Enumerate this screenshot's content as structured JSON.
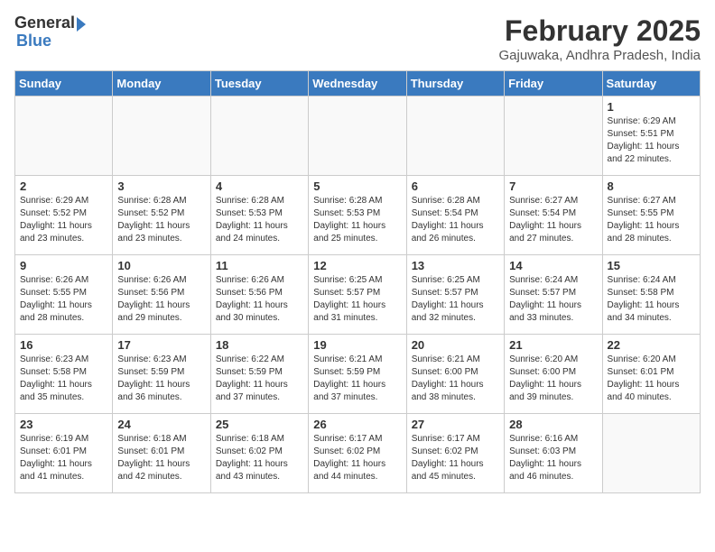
{
  "header": {
    "logo_general": "General",
    "logo_blue": "Blue",
    "month_title": "February 2025",
    "location": "Gajuwaka, Andhra Pradesh, India"
  },
  "weekdays": [
    "Sunday",
    "Monday",
    "Tuesday",
    "Wednesday",
    "Thursday",
    "Friday",
    "Saturday"
  ],
  "weeks": [
    [
      {
        "day": "",
        "info": ""
      },
      {
        "day": "",
        "info": ""
      },
      {
        "day": "",
        "info": ""
      },
      {
        "day": "",
        "info": ""
      },
      {
        "day": "",
        "info": ""
      },
      {
        "day": "",
        "info": ""
      },
      {
        "day": "1",
        "info": "Sunrise: 6:29 AM\nSunset: 5:51 PM\nDaylight: 11 hours\nand 22 minutes."
      }
    ],
    [
      {
        "day": "2",
        "info": "Sunrise: 6:29 AM\nSunset: 5:52 PM\nDaylight: 11 hours\nand 23 minutes."
      },
      {
        "day": "3",
        "info": "Sunrise: 6:28 AM\nSunset: 5:52 PM\nDaylight: 11 hours\nand 23 minutes."
      },
      {
        "day": "4",
        "info": "Sunrise: 6:28 AM\nSunset: 5:53 PM\nDaylight: 11 hours\nand 24 minutes."
      },
      {
        "day": "5",
        "info": "Sunrise: 6:28 AM\nSunset: 5:53 PM\nDaylight: 11 hours\nand 25 minutes."
      },
      {
        "day": "6",
        "info": "Sunrise: 6:28 AM\nSunset: 5:54 PM\nDaylight: 11 hours\nand 26 minutes."
      },
      {
        "day": "7",
        "info": "Sunrise: 6:27 AM\nSunset: 5:54 PM\nDaylight: 11 hours\nand 27 minutes."
      },
      {
        "day": "8",
        "info": "Sunrise: 6:27 AM\nSunset: 5:55 PM\nDaylight: 11 hours\nand 28 minutes."
      }
    ],
    [
      {
        "day": "9",
        "info": "Sunrise: 6:26 AM\nSunset: 5:55 PM\nDaylight: 11 hours\nand 28 minutes."
      },
      {
        "day": "10",
        "info": "Sunrise: 6:26 AM\nSunset: 5:56 PM\nDaylight: 11 hours\nand 29 minutes."
      },
      {
        "day": "11",
        "info": "Sunrise: 6:26 AM\nSunset: 5:56 PM\nDaylight: 11 hours\nand 30 minutes."
      },
      {
        "day": "12",
        "info": "Sunrise: 6:25 AM\nSunset: 5:57 PM\nDaylight: 11 hours\nand 31 minutes."
      },
      {
        "day": "13",
        "info": "Sunrise: 6:25 AM\nSunset: 5:57 PM\nDaylight: 11 hours\nand 32 minutes."
      },
      {
        "day": "14",
        "info": "Sunrise: 6:24 AM\nSunset: 5:57 PM\nDaylight: 11 hours\nand 33 minutes."
      },
      {
        "day": "15",
        "info": "Sunrise: 6:24 AM\nSunset: 5:58 PM\nDaylight: 11 hours\nand 34 minutes."
      }
    ],
    [
      {
        "day": "16",
        "info": "Sunrise: 6:23 AM\nSunset: 5:58 PM\nDaylight: 11 hours\nand 35 minutes."
      },
      {
        "day": "17",
        "info": "Sunrise: 6:23 AM\nSunset: 5:59 PM\nDaylight: 11 hours\nand 36 minutes."
      },
      {
        "day": "18",
        "info": "Sunrise: 6:22 AM\nSunset: 5:59 PM\nDaylight: 11 hours\nand 37 minutes."
      },
      {
        "day": "19",
        "info": "Sunrise: 6:21 AM\nSunset: 5:59 PM\nDaylight: 11 hours\nand 37 minutes."
      },
      {
        "day": "20",
        "info": "Sunrise: 6:21 AM\nSunset: 6:00 PM\nDaylight: 11 hours\nand 38 minutes."
      },
      {
        "day": "21",
        "info": "Sunrise: 6:20 AM\nSunset: 6:00 PM\nDaylight: 11 hours\nand 39 minutes."
      },
      {
        "day": "22",
        "info": "Sunrise: 6:20 AM\nSunset: 6:01 PM\nDaylight: 11 hours\nand 40 minutes."
      }
    ],
    [
      {
        "day": "23",
        "info": "Sunrise: 6:19 AM\nSunset: 6:01 PM\nDaylight: 11 hours\nand 41 minutes."
      },
      {
        "day": "24",
        "info": "Sunrise: 6:18 AM\nSunset: 6:01 PM\nDaylight: 11 hours\nand 42 minutes."
      },
      {
        "day": "25",
        "info": "Sunrise: 6:18 AM\nSunset: 6:02 PM\nDaylight: 11 hours\nand 43 minutes."
      },
      {
        "day": "26",
        "info": "Sunrise: 6:17 AM\nSunset: 6:02 PM\nDaylight: 11 hours\nand 44 minutes."
      },
      {
        "day": "27",
        "info": "Sunrise: 6:17 AM\nSunset: 6:02 PM\nDaylight: 11 hours\nand 45 minutes."
      },
      {
        "day": "28",
        "info": "Sunrise: 6:16 AM\nSunset: 6:03 PM\nDaylight: 11 hours\nand 46 minutes."
      },
      {
        "day": "",
        "info": ""
      }
    ]
  ]
}
